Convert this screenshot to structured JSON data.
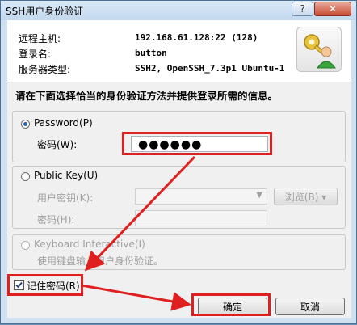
{
  "window": {
    "title": "SSH用户身份验证",
    "help_glyph": "?",
    "close_glyph": "✕"
  },
  "header": {
    "host_label": "远程主机:",
    "host_value": "192.168.61.128:22 (128)",
    "login_label": "登录名:",
    "login_value": "button",
    "server_label": "服务器类型:",
    "server_value": "SSH2, OpenSSH_7.3p1 Ubuntu-1",
    "icon": "key-user-icon"
  },
  "instruction": "请在下面选择恰当的身份验证方法并提供登录所需的信息。",
  "password_method": {
    "label": "Password(P)",
    "selected": true,
    "field_label": "密码(W):",
    "field_value": "●●●●●●"
  },
  "publickey_method": {
    "label": "Public Key(U)",
    "selected": false,
    "key_label": "用户密钥(K):",
    "key_value": "",
    "browse_label": "浏览(B) ▾",
    "passphrase_label": "密码(H):"
  },
  "keyboard_method": {
    "label": "Keyboard Interactive(I)",
    "selected": false,
    "description": "使用键盘输入用户身份验证。"
  },
  "remember": {
    "label": "记住密码(R)",
    "checked": true
  },
  "buttons": {
    "ok": "确定",
    "cancel": "取消"
  },
  "colors": {
    "annotation": "#e02020",
    "accent": "#2a62b8"
  }
}
